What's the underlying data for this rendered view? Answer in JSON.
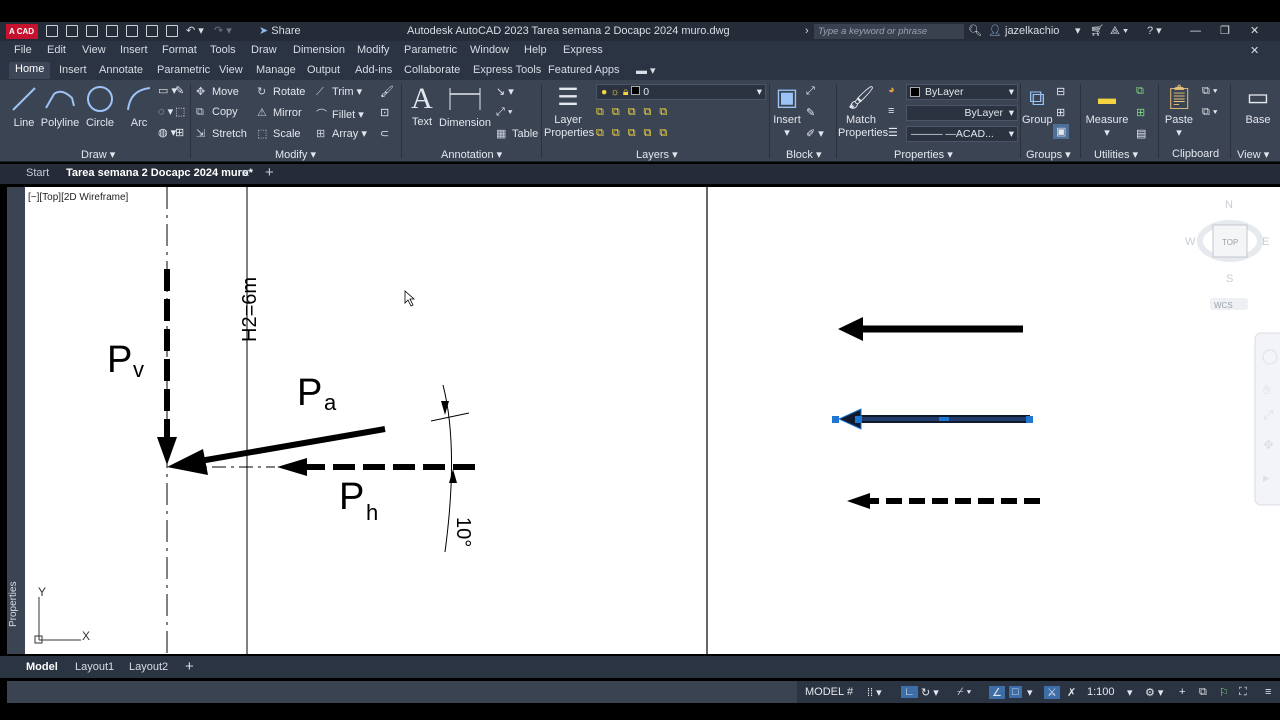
{
  "title_bar": {
    "app_badge": "CAD",
    "share": "Share",
    "window_title": "Autodesk AutoCAD 2023   Tarea semana 2 Docapc 2024 muro.dwg",
    "search_placeholder": "Type a keyword or phrase",
    "user": "jazelkachio"
  },
  "menu": [
    "File",
    "Edit",
    "View",
    "Insert",
    "Format",
    "Tools",
    "Draw",
    "Dimension",
    "Modify",
    "Parametric",
    "Window",
    "Help",
    "Express"
  ],
  "ribbon_tabs": [
    "Home",
    "Insert",
    "Annotate",
    "Parametric",
    "View",
    "Manage",
    "Output",
    "Add-ins",
    "Collaborate",
    "Express Tools",
    "Featured Apps"
  ],
  "ribbon": {
    "draw": {
      "line": "Line",
      "polyline": "Polyline",
      "circle": "Circle",
      "arc": "Arc",
      "title": "Draw"
    },
    "modify": {
      "move": "Move",
      "rotate": "Rotate",
      "trim": "Trim",
      "copy": "Copy",
      "mirror": "Mirror",
      "fillet": "Fillet",
      "stretch": "Stretch",
      "scale": "Scale",
      "array": "Array",
      "title": "Modify"
    },
    "annotation": {
      "text": "Text",
      "dimension": "Dimension",
      "table": "Table",
      "title": "Annotation"
    },
    "layers": {
      "layer_properties_1": "Layer",
      "layer_properties_2": "Properties",
      "current_layer": "0",
      "title": "Layers"
    },
    "block": {
      "insert": "Insert",
      "title": "Block"
    },
    "properties": {
      "match_1": "Match",
      "match_2": "Properties",
      "color": "ByLayer",
      "lineweight": "ByLayer",
      "linetype": "——— —ACAD...",
      "title": "Properties"
    },
    "groups": {
      "group": "Group",
      "title": "Groups"
    },
    "utilities": {
      "measure": "Measure",
      "title": "Utilities"
    },
    "clipboard": {
      "paste": "Paste",
      "title": "Clipboard"
    },
    "view": {
      "base": "Base",
      "title": "View"
    }
  },
  "file_tabs": {
    "start": "Start",
    "doc": "Tarea semana 2 Docapc 2024 muro*"
  },
  "viewport": {
    "label": "[−][Top][2D Wireframe]",
    "side_palette": "Properties",
    "drawing": {
      "dim_text": "H2=6m",
      "pv_main": "P",
      "pv_sub": "v",
      "pa_main": "P",
      "pa_sub": "a",
      "ph_main": "P",
      "ph_sub": "h",
      "angle": "10°"
    },
    "viewcube": {
      "n": "N",
      "s": "S",
      "e": "E",
      "w": "W",
      "top": "TOP",
      "wcs": "WCS"
    },
    "ucs": {
      "x": "X",
      "y": "Y"
    }
  },
  "layout_tabs": [
    "Model",
    "Layout1",
    "Layout2"
  ],
  "status": {
    "model": "MODEL",
    "scale": "1:100"
  },
  "colors": {
    "ribbon_bg": "#3b4453",
    "titlebar_bg": "#252c38",
    "selection_blue": "#1f77d4",
    "app_red": "#c4122f"
  }
}
